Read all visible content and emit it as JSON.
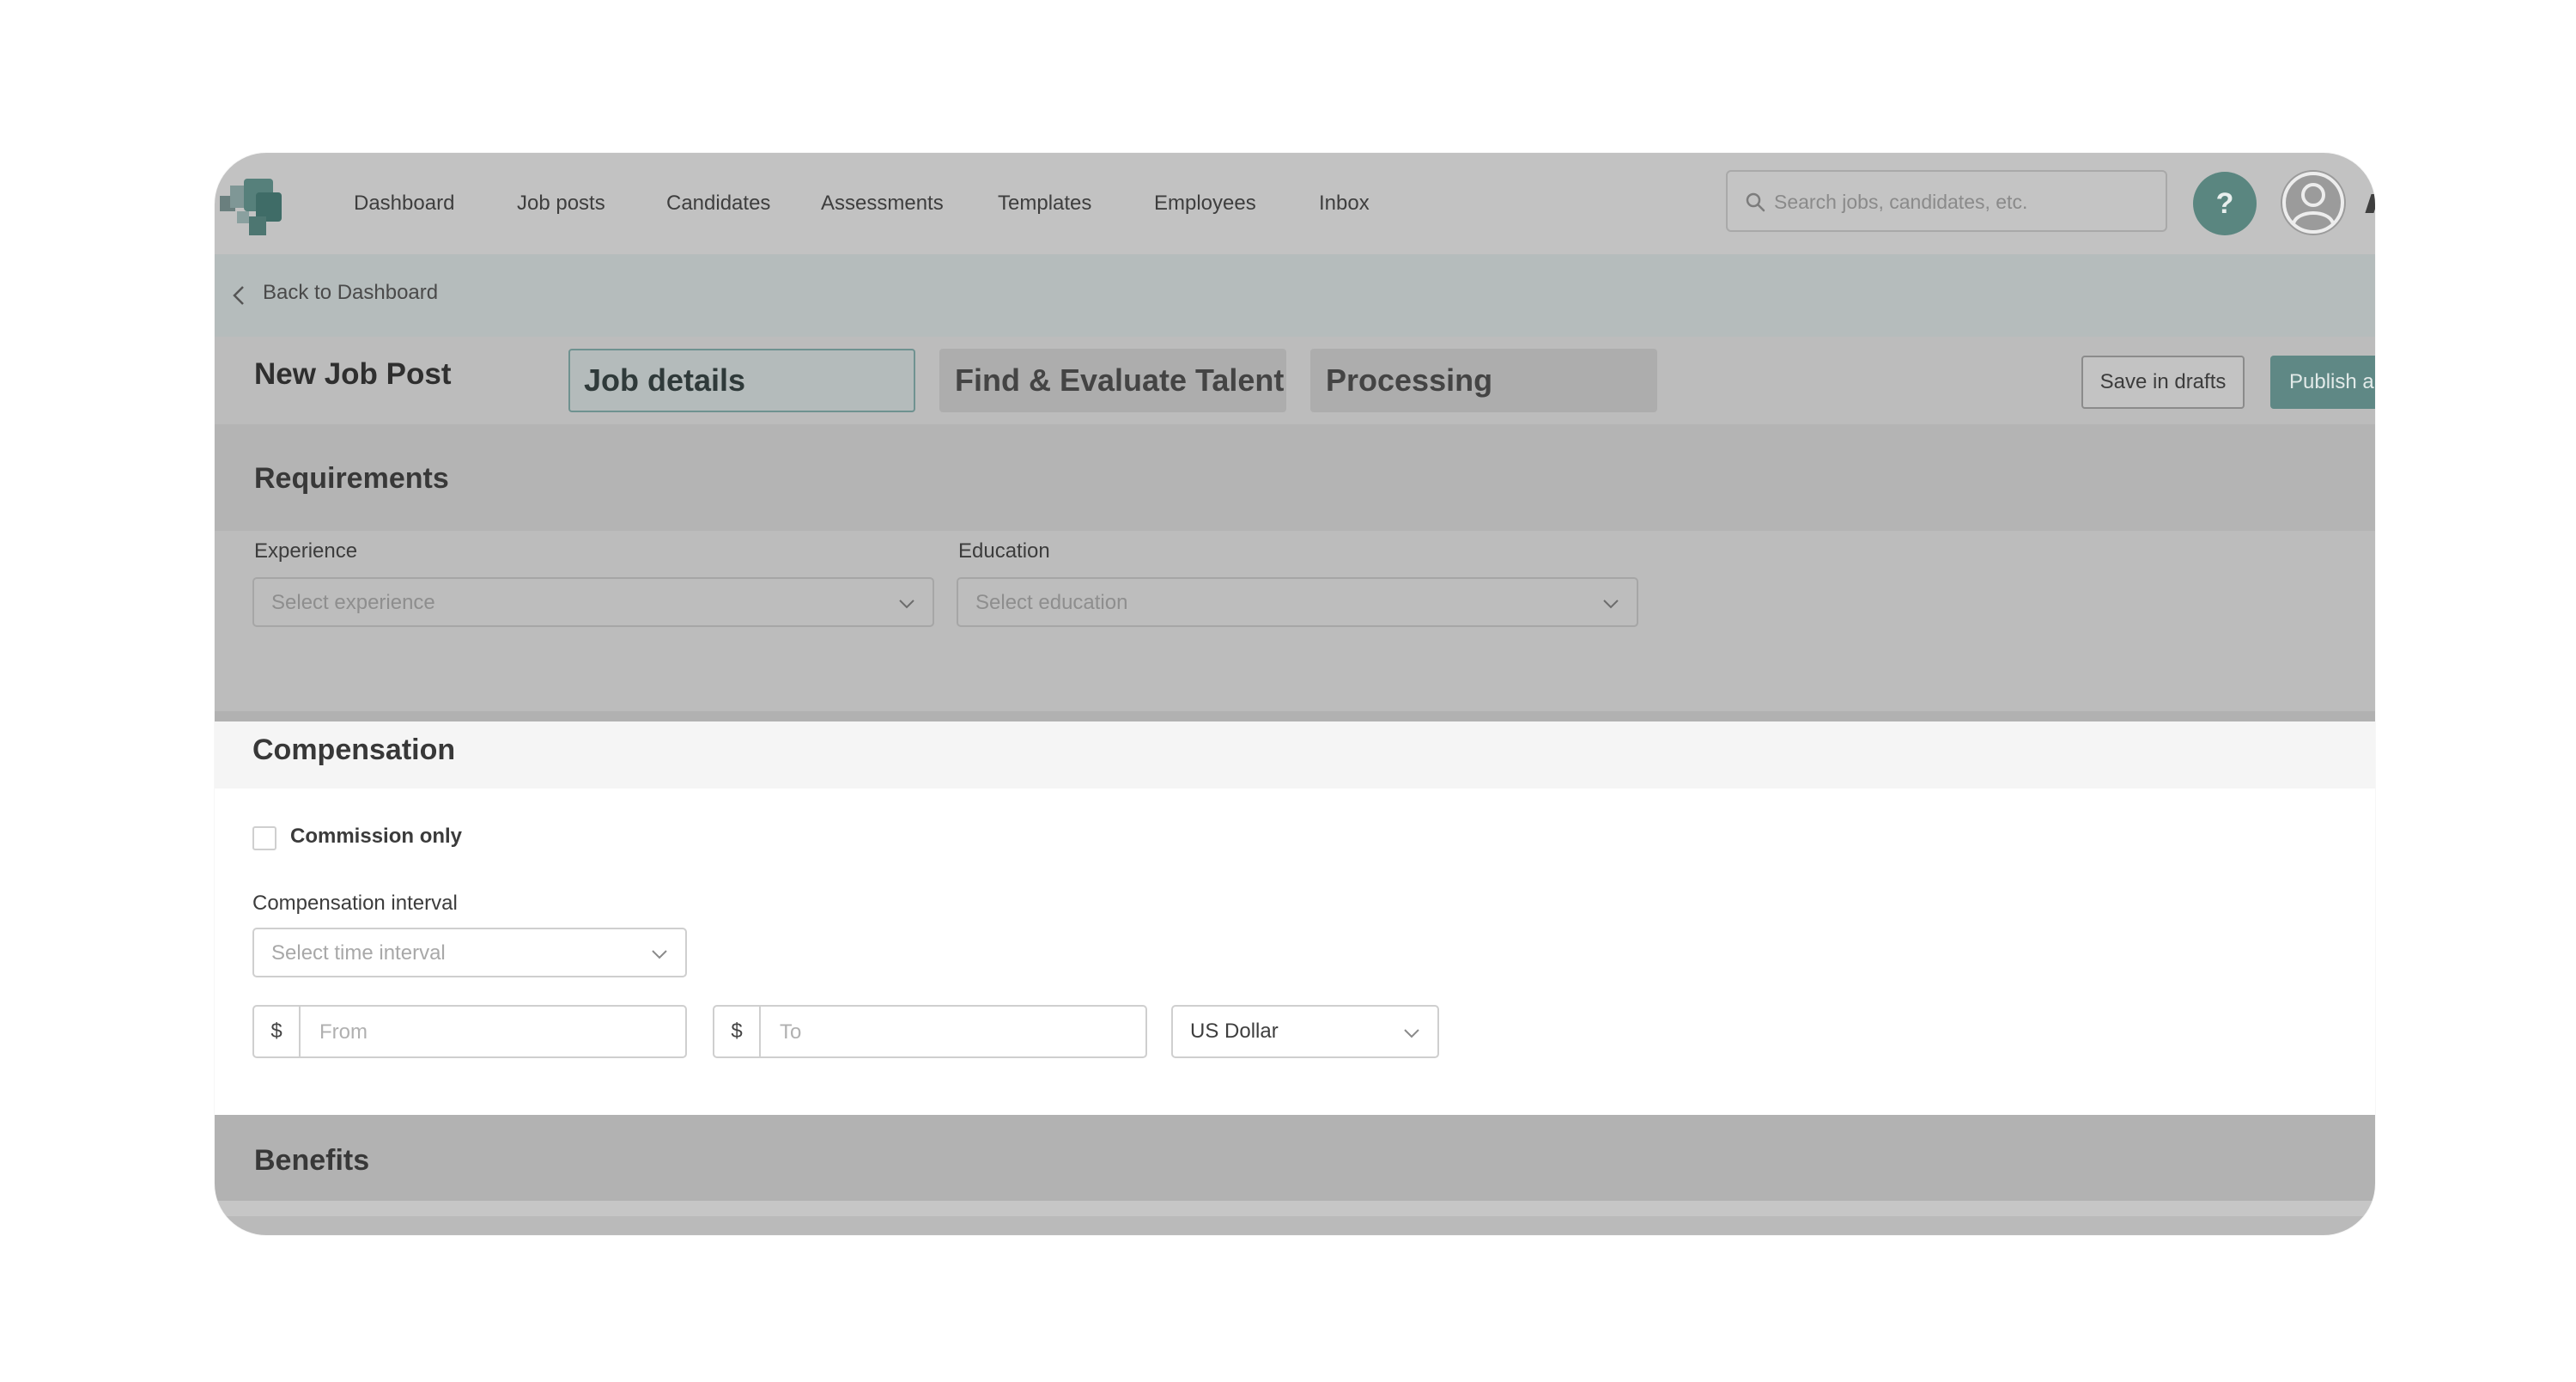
{
  "nav": {
    "links": [
      "Dashboard",
      "Job posts",
      "Candidates",
      "Assessments",
      "Templates",
      "Employees",
      "Inbox"
    ],
    "search_placeholder": "Search jobs, candidates, etc.",
    "help_label": "?"
  },
  "back_link": "Back to Dashboard",
  "header": {
    "title": "New Job Post",
    "tabs": [
      "Job details",
      "Find & Evaluate Talent",
      "Processing"
    ],
    "active_tab": "Job details",
    "save_drafts": "Save in drafts",
    "publish": "Publish a"
  },
  "requirements": {
    "title": "Requirements",
    "experience_label": "Experience",
    "experience_placeholder": "Select experience",
    "education_label": "Education",
    "education_placeholder": "Select education"
  },
  "compensation": {
    "title": "Compensation",
    "commission_only_label": "Commission only",
    "interval_label": "Compensation interval",
    "interval_placeholder": "Select time interval",
    "currency_symbol": "$",
    "from_placeholder": "From",
    "to_placeholder": "To",
    "currency_value": "US Dollar"
  },
  "benefits": {
    "title": "Benefits"
  },
  "colors": {
    "accent": "#5f8885",
    "overlay": "#bcbcbc"
  }
}
